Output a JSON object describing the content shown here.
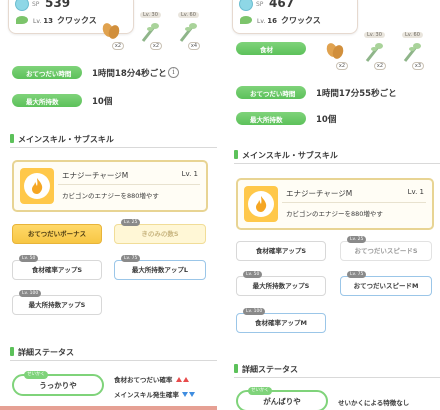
{
  "left": {
    "header": {
      "sp_label": "SP",
      "sp_value": "539",
      "lv_prefix": "Lv.",
      "level": "13",
      "name": "クワックス"
    },
    "ingredients": [
      {
        "lv": "",
        "count": "x2"
      },
      {
        "lv": "Lv. 30",
        "count": "x2"
      },
      {
        "lv": "Lv. 60",
        "count": "x4"
      }
    ],
    "help_time_label": "おてつだい時間",
    "help_time_value": "1時間18分4秒ごと",
    "max_carry_label": "最大所持数",
    "max_carry_value": "10個",
    "section_skill": "メインスキル・サブスキル",
    "main_skill": {
      "name": "エナジーチャージM",
      "level": "Lv. 1",
      "desc": "カビゴンのエナジーを880増やす"
    },
    "sub_skills": [
      {
        "label": "おてつだいボーナス",
        "lock": ""
      },
      {
        "label": "きのみの数S",
        "lock": "Lv. 25"
      },
      {
        "label": "食材確率アップS",
        "lock": "Lv. 50"
      },
      {
        "label": "最大所持数アップL",
        "lock": "Lv. 75"
      },
      {
        "label": "最大所持数アップS",
        "lock": "Lv. 100"
      }
    ],
    "section_detail": "詳細ステータス",
    "nature_tag": "せいかく",
    "nature_name": "うっかりや",
    "effect_1": "食材おてつだい確率",
    "effect_2": "メインスキル発生確率"
  },
  "right": {
    "header": {
      "sp_label": "SP",
      "sp_value": "467",
      "lv_prefix": "Lv.",
      "level": "16",
      "name": "クワックス"
    },
    "top_pill_label": "食材",
    "ingredients": [
      {
        "lv": "",
        "count": "x2"
      },
      {
        "lv": "Lv. 30",
        "count": "x2"
      },
      {
        "lv": "Lv. 60",
        "count": "x3"
      }
    ],
    "help_time_label": "おてつだい時間",
    "help_time_value": "1時間17分55秒ごと",
    "max_carry_label": "最大所持数",
    "max_carry_value": "10個",
    "section_skill": "メインスキル・サブスキル",
    "main_skill": {
      "name": "エナジーチャージM",
      "level": "Lv. 1",
      "desc": "カビゴンのエナジーを880増やす"
    },
    "sub_skills": [
      {
        "label": "食材確率アップS",
        "lock": ""
      },
      {
        "label": "おてつだいスピードS",
        "lock": "Lv. 25"
      },
      {
        "label": "最大所持数アップS",
        "lock": "Lv. 50"
      },
      {
        "label": "おてつだいスピードM",
        "lock": "Lv. 75"
      },
      {
        "label": "食材確率アップM",
        "lock": "Lv. 100"
      }
    ],
    "section_detail": "詳細ステータス",
    "nature_tag": "せいかく",
    "nature_name": "がんばりや",
    "effect_1": "せいかくによる特徴なし"
  },
  "colors": {
    "accent_green": "#5cc15a",
    "skill_gold": "#ffc84a",
    "up_red": "#e74c4c",
    "down_blue": "#3f8de0"
  },
  "icons": [
    "sp-orb-icon",
    "leaf-icon",
    "almond-ingredient-icon",
    "sprout-ingredient-icon",
    "info-icon",
    "flame-icon",
    "lock-icon"
  ]
}
